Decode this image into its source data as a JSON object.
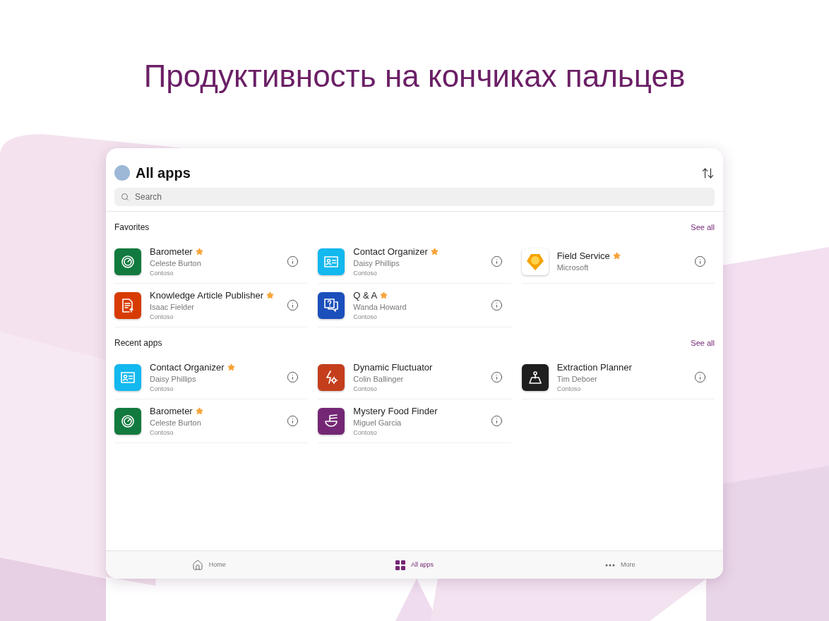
{
  "headline": "Продуктивность на кончиках пальцев",
  "header": {
    "title": "All apps",
    "search": {
      "placeholder": "Search"
    }
  },
  "sections": [
    {
      "title": "Favorites",
      "link": "See all",
      "apps": [
        {
          "name": "Barometer",
          "favorite": true,
          "author": "Celeste Burton",
          "publisher": "Contoso",
          "kind": "gauge",
          "color": "#127a3e"
        },
        {
          "name": "Contact Organizer",
          "favorite": true,
          "author": "Daisy Phillips",
          "publisher": "Contoso",
          "kind": "card",
          "color": "#12b8ee"
        },
        {
          "name": "Field Service",
          "favorite": true,
          "author": "Microsoft",
          "kind": "hexpin",
          "color": "#ffffff"
        },
        {
          "name": "Knowledge Article Publisher",
          "favorite": true,
          "author": "Isaac Fielder",
          "publisher": "Contoso",
          "kind": "document",
          "color": "#d83b01"
        },
        {
          "name": "Q & A",
          "favorite": true,
          "author": "Wanda Howard",
          "publisher": "Contoso",
          "kind": "question",
          "color": "#1b4fbb"
        }
      ]
    },
    {
      "title": "Recent apps",
      "link": "See all",
      "apps": [
        {
          "name": "Contact Organizer",
          "favorite": true,
          "author": "Daisy Phillips",
          "publisher": "Contoso",
          "kind": "card",
          "color": "#12b8ee"
        },
        {
          "name": "Dynamic Fluctuator",
          "favorite": false,
          "author": "Colin Ballinger",
          "publisher": "Contoso",
          "kind": "boltgear",
          "color": "#c43e1c"
        },
        {
          "name": "Extraction Planner",
          "favorite": false,
          "author": "Tim Deboer",
          "publisher": "Contoso",
          "kind": "figure",
          "color": "#1f1f1f"
        },
        {
          "name": "Barometer",
          "favorite": true,
          "author": "Celeste Burton",
          "publisher": "Contoso",
          "kind": "gauge",
          "color": "#127a3e"
        },
        {
          "name": "Mystery Food Finder",
          "favorite": false,
          "author": "Miguel Garcia",
          "publisher": "Contoso",
          "kind": "bowl",
          "color": "#742774"
        }
      ]
    }
  ],
  "nav": [
    {
      "label": "Home",
      "kind": "home",
      "selected": false
    },
    {
      "label": "All apps",
      "kind": "grid",
      "selected": true
    },
    {
      "label": "More",
      "kind": "more",
      "selected": false
    }
  ]
}
